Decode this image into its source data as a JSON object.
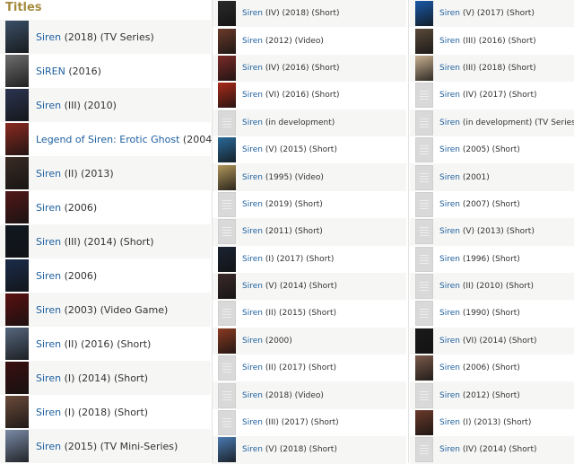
{
  "heading": "Titles",
  "colors": {
    "link": "#1d5f9e",
    "heading": "#a58b3c",
    "placeholder": "#d9d9d9"
  },
  "col1": [
    {
      "title": "Siren",
      "meta": "(2018) (TV Series)",
      "poster": "#3a4f66"
    },
    {
      "title": "SiREN",
      "meta": "(2016)",
      "poster": "#6e6e6e"
    },
    {
      "title": "Siren",
      "meta": "(III) (2010)",
      "poster": "#2b3550"
    },
    {
      "title": "Legend of Siren: Erotic Ghost",
      "meta": "(2004)",
      "poster": "#8a2a20"
    },
    {
      "title": "Siren",
      "meta": "(II) (2013)",
      "poster": "#3a2b24"
    },
    {
      "title": "Siren",
      "meta": "(2006)",
      "poster": "#521818"
    },
    {
      "title": "Siren",
      "meta": "(III) (2014) (Short)",
      "poster": "#111822"
    },
    {
      "title": "Siren",
      "meta": "(2006)",
      "poster": "#1a2c4a"
    },
    {
      "title": "Siren",
      "meta": "(2003) (Video Game)",
      "poster": "#5a1010"
    },
    {
      "title": "Siren",
      "meta": "(II) (2016) (Short)",
      "poster": "#56677e"
    },
    {
      "title": "Siren",
      "meta": "(I) (2014) (Short)",
      "poster": "#3a1010"
    },
    {
      "title": "Siren",
      "meta": "(I) (2018) (Short)",
      "poster": "#6a4a3a"
    },
    {
      "title": "Siren",
      "meta": "(2015) (TV Mini-Series)",
      "poster": "#7a8aa6"
    }
  ],
  "col2": [
    {
      "title": "Siren",
      "meta": "(IV) (2018) (Short)",
      "poster": "#2a2a2a"
    },
    {
      "title": "Siren",
      "meta": "(2012) (Video)",
      "poster": "#6a3a2a"
    },
    {
      "title": "Siren",
      "meta": "(IV) (2016) (Short)",
      "poster": "#7a2a28"
    },
    {
      "title": "Siren",
      "meta": "(VI) (2016) (Short)",
      "poster": "#a82a1a"
    },
    {
      "title": "Siren",
      "meta": "(in development)",
      "poster": ""
    },
    {
      "title": "Siren",
      "meta": "(V) (2015) (Short)",
      "poster": "#2a6a9a"
    },
    {
      "title": "Siren",
      "meta": "(1995) (Video)",
      "poster": "#b0955a"
    },
    {
      "title": "Siren",
      "meta": "(2019) (Short)",
      "poster": ""
    },
    {
      "title": "Siren",
      "meta": "(2011) (Short)",
      "poster": ""
    },
    {
      "title": "Siren",
      "meta": "(I) (2017) (Short)",
      "poster": "#1a2232"
    },
    {
      "title": "Siren",
      "meta": "(V) (2014) (Short)",
      "poster": "#3a2a2a"
    },
    {
      "title": "Siren",
      "meta": "(II) (2015) (Short)",
      "poster": ""
    },
    {
      "title": "Siren",
      "meta": "(2000)",
      "poster": "#8a3a22"
    },
    {
      "title": "Siren",
      "meta": "(II) (2017) (Short)",
      "poster": ""
    },
    {
      "title": "Siren",
      "meta": "(2018) (Video)",
      "poster": ""
    },
    {
      "title": "Siren",
      "meta": "(III) (2017) (Short)",
      "poster": ""
    },
    {
      "title": "Siren",
      "meta": "(V) (2018) (Short)",
      "poster": "#4a7ab0"
    }
  ],
  "col3": [
    {
      "title": "Siren",
      "meta": "(V) (2017) (Short)",
      "poster": "#1a5aa8"
    },
    {
      "title": "Siren",
      "meta": "(III) (2016) (Short)",
      "poster": "#5a4a3a"
    },
    {
      "title": "Siren",
      "meta": "(III) (2018) (Short)",
      "poster": "#c8b090"
    },
    {
      "title": "Siren",
      "meta": "(IV) (2017) (Short)",
      "poster": ""
    },
    {
      "title": "Siren",
      "meta": "(in development) (TV Series)",
      "poster": ""
    },
    {
      "title": "Siren",
      "meta": "(2005) (Short)",
      "poster": ""
    },
    {
      "title": "Siren",
      "meta": "(2001)",
      "poster": ""
    },
    {
      "title": "Siren",
      "meta": "(2007) (Short)",
      "poster": ""
    },
    {
      "title": "Siren",
      "meta": "(V) (2013) (Short)",
      "poster": ""
    },
    {
      "title": "Siren",
      "meta": "(1996) (Short)",
      "poster": ""
    },
    {
      "title": "Siren",
      "meta": "(II) (2010) (Short)",
      "poster": ""
    },
    {
      "title": "Siren",
      "meta": "(1990) (Short)",
      "poster": ""
    },
    {
      "title": "Siren",
      "meta": "(VI) (2014) (Short)",
      "poster": "#1a1a1a"
    },
    {
      "title": "Siren",
      "meta": "(2006) (Short)",
      "poster": "#7a5a4a"
    },
    {
      "title": "Siren",
      "meta": "(2012) (Short)",
      "poster": ""
    },
    {
      "title": "Siren",
      "meta": "(I) (2013) (Short)",
      "poster": "#6a3a2a"
    },
    {
      "title": "Siren",
      "meta": "(IV) (2014) (Short)",
      "poster": ""
    }
  ]
}
